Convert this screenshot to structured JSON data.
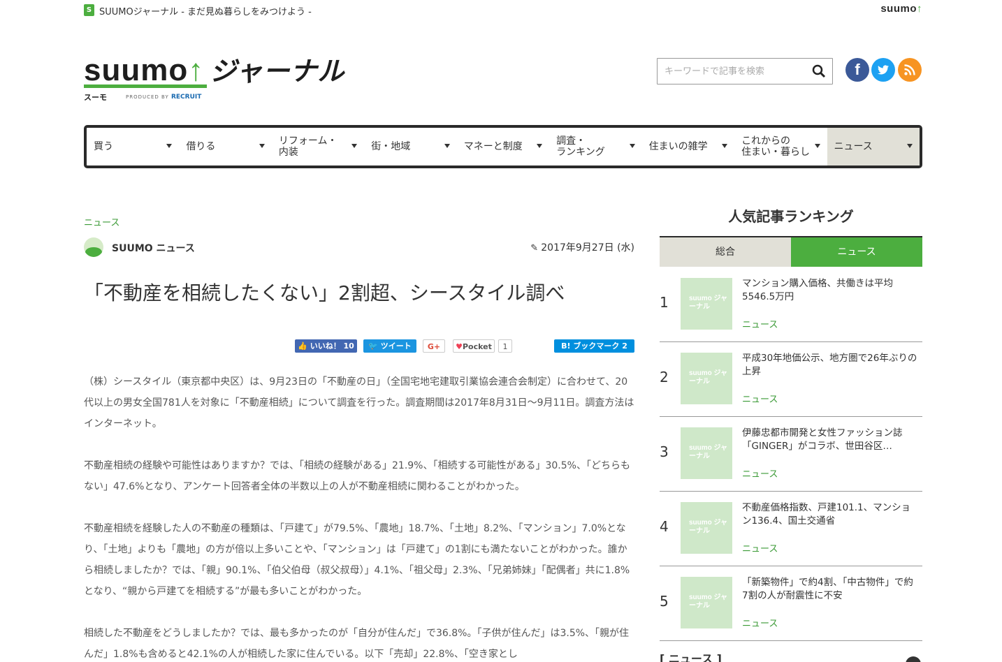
{
  "topbar": {
    "tagline": "SUUMOジャーナル - まだ見ぬ暮らしをみつけよう -",
    "logo_text": "suumo",
    "icon_letter": "S"
  },
  "logo": {
    "main": "suumo",
    "main_suffix": "ジャーナル",
    "sub": "スーモ",
    "produced_by": "PRODUCED BY",
    "recruit": "RECRUIT"
  },
  "search": {
    "placeholder": "キーワードで記事を検索"
  },
  "social": {
    "facebook": "f",
    "twitter": "t",
    "rss": "rss"
  },
  "nav": [
    {
      "label": "買う"
    },
    {
      "label": "借りる"
    },
    {
      "label": "リフォーム・\n内装"
    },
    {
      "label": "街・地域"
    },
    {
      "label": "マネーと制度"
    },
    {
      "label": "調査・\nランキング"
    },
    {
      "label": "住まいの雑学"
    },
    {
      "label": "これからの\n住まい・暮らし"
    },
    {
      "label": "ニュース",
      "active": true
    }
  ],
  "article": {
    "category": "ニュース",
    "author": "SUUMO ニュース",
    "date": "2017年9月27日 (水)",
    "title": "「不動産を相続したくない」2割超、シースタイル調べ",
    "share": {
      "like": "いいね！ 10",
      "tweet": "ツイート",
      "gplus": "G+",
      "pocket": "Pocket",
      "pocket_count": "1",
      "hatena": "B! ブックマーク  2"
    },
    "paragraphs": [
      "（株）シースタイル（東京都中央区）は、9月23日の「不動産の日」（全国宅地宅建取引業協会連合会制定）に合わせて、20代以上の男女全国781人を対象に「不動産相続」について調査を行った。調査期間は2017年8月31日～9月11日。調査方法はインターネット。",
      "不動産相続の経験や可能性はありますか？では、「相続の経験がある」21.9%、「相続する可能性がある」30.5%、「どちらもない」47.6%となり、アンケート回答者全体の半数以上の人が不動産相続に関わることがわかった。",
      "不動産相続を経験した人の不動産の種類は、「戸建て」が79.5%、「農地」18.7%、「土地」8.2%、「マンション」7.0%となり、「土地」よりも「農地」の方が倍以上多いことや、「マンション」は「戸建て」の1割にも満たないことがわかった。誰から相続しましたか？では、「親」90.1%、「伯父伯母（叔父叔母）」4.1%、「祖父母」2.3%、「兄弟姉妹」「配偶者」共に1.8%となり、“親から戸建てを相続する”が最も多いことがわかった。",
      "相続した不動産をどうしましたか？では、最も多かったのが「自分が住んだ」で36.8%。「子供が住んだ」は3.5%、「親が住んだ」1.8%も含めると42.1%の人が相続した家に住んでいる。以下「売却」22.8%、「空き家とし"
    ]
  },
  "ranking": {
    "heading": "人気記事ランキング",
    "tabs": [
      {
        "label": "総合"
      },
      {
        "label": "ニュース",
        "active": true
      }
    ],
    "thumb_text": "suumo ジャーナル",
    "items": [
      {
        "rank": "1",
        "title": "マンション購入価格、共働きは平均5546.5万円",
        "category": "ニュース"
      },
      {
        "rank": "2",
        "title": "平成30年地価公示、地方圏で26年ぶりの上昇",
        "category": "ニュース"
      },
      {
        "rank": "3",
        "title": "伊藤忠都市開発と女性ファッション誌「GINGER」がコラボ、世田谷区…",
        "category": "ニュース"
      },
      {
        "rank": "4",
        "title": "不動産価格指数、戸建101.1、マンション136.4、国土交通省",
        "category": "ニュース"
      },
      {
        "rank": "5",
        "title": "「新築物件」で約4割、「中古物件」で約7割の人が耐震性に不安",
        "category": "ニュース"
      }
    ],
    "next_heading": "[ ニュース ]"
  }
}
